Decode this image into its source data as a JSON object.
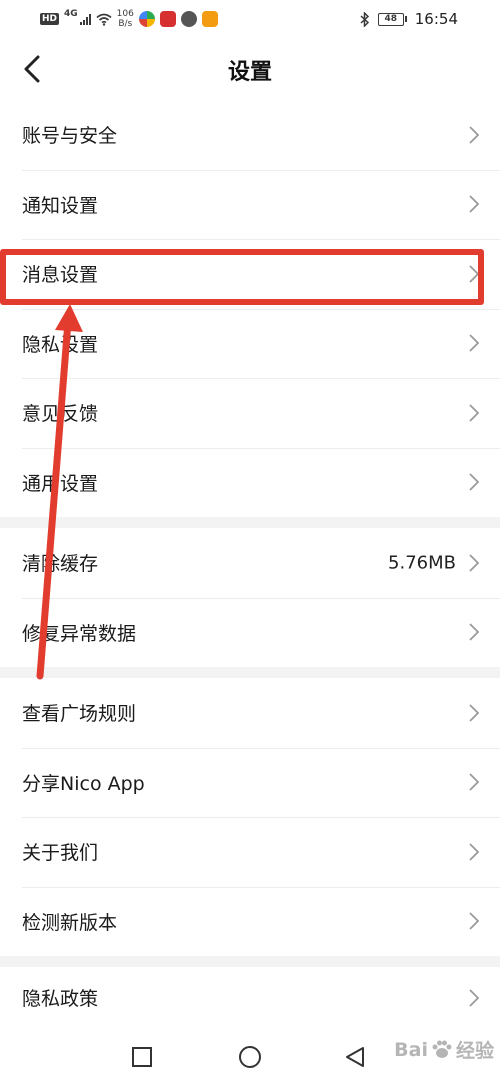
{
  "status_bar": {
    "hd": "HD",
    "network": "4G",
    "speed_value": "106",
    "speed_unit": "B/s",
    "battery": "48",
    "time": "16:54",
    "icons": [
      "wifi-icon",
      "signal-icon",
      "bluetooth-icon",
      "battery-icon"
    ]
  },
  "header": {
    "title": "设置",
    "back_icon": "chevron-left-icon"
  },
  "groups": [
    {
      "items": [
        {
          "label": "账号与安全"
        },
        {
          "label": "通知设置"
        },
        {
          "label": "消息设置"
        },
        {
          "label": "隐私设置"
        },
        {
          "label": "意见反馈"
        },
        {
          "label": "通用设置"
        }
      ]
    },
    {
      "items": [
        {
          "label": "清除缓存",
          "value": "5.76MB"
        },
        {
          "label": "修复异常数据"
        }
      ]
    },
    {
      "items": [
        {
          "label": "查看广场规则"
        },
        {
          "label": "分享Nico App"
        },
        {
          "label": "关于我们"
        },
        {
          "label": "检测新版本"
        }
      ]
    },
    {
      "items": [
        {
          "label": "隐私政策"
        }
      ]
    }
  ],
  "annotation": {
    "color": "#e23c2e",
    "target": "消息设置"
  },
  "system_nav": {
    "buttons": [
      "recent-apps-icon",
      "home-icon",
      "back-triangle-icon"
    ]
  },
  "watermark": {
    "text": "Bai",
    "suffix": "经验"
  },
  "colors": {
    "background": "#f3f3f3",
    "divider": "#ececec",
    "text": "#1b1b1b",
    "chevron": "#9a9a9a"
  }
}
